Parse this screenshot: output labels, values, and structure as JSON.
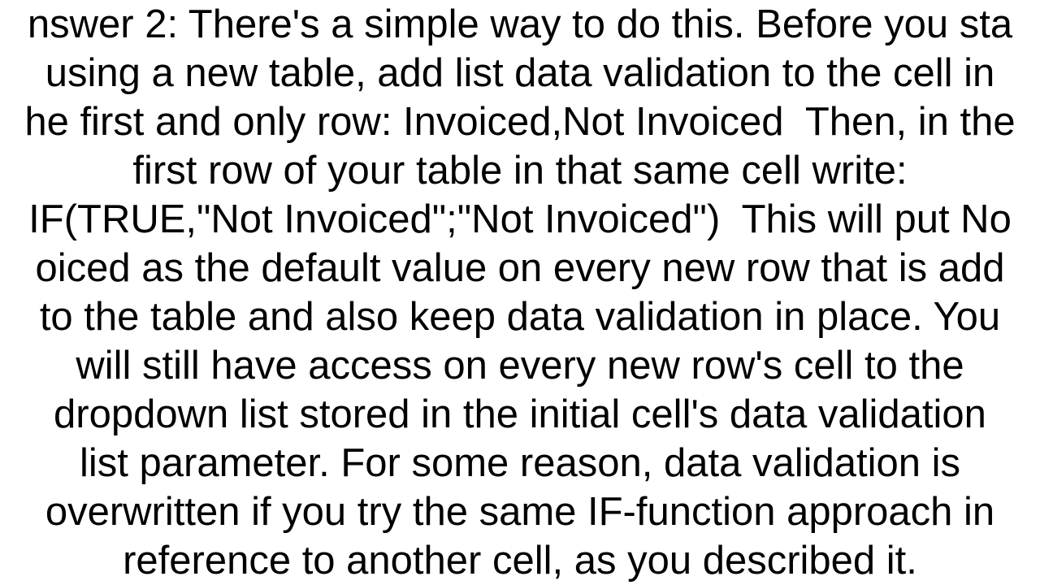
{
  "answer": {
    "text": "nswer 2: There's a simple way to do this. Before you sta\n using a new table, add list data validation to the cell in \nhe first and only row: Invoiced,Not Invoiced  Then, in the\nfirst row of your table in that same cell write:\nIF(TRUE,\"Not Invoiced\";\"Not Invoiced\")  This will put No\noiced as the default value on every new row that is add\nto the table and also keep data validation in place. You\nwill still have access on every new row's cell to the\ndropdown list stored in the initial cell's data validation\nlist parameter. For some reason, data validation is\noverwritten if you try the same IF-function approach in\nreference to another cell, as you described it."
  }
}
